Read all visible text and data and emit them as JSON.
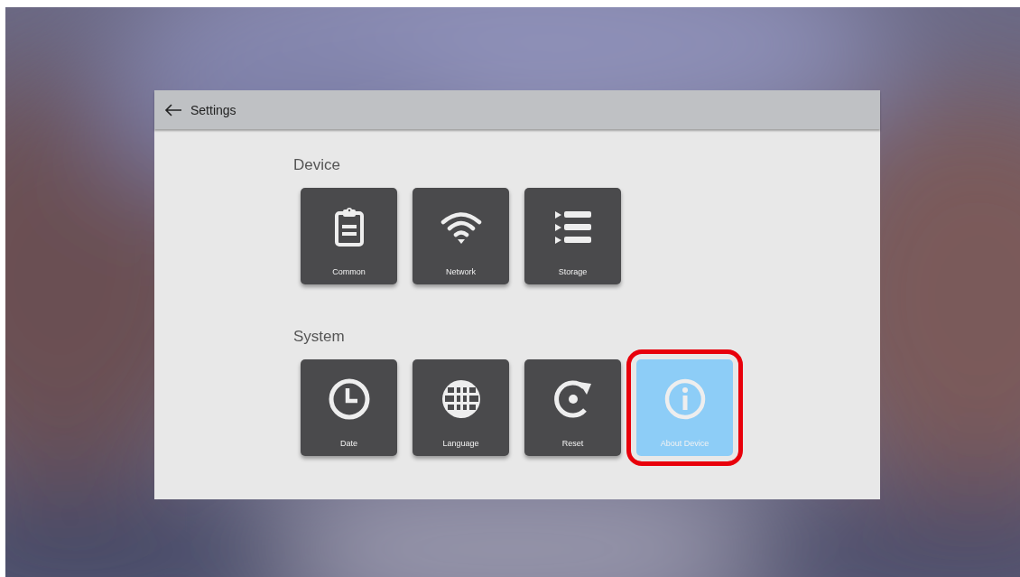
{
  "header": {
    "title": "Settings"
  },
  "sections": [
    {
      "title": "Device",
      "tiles": [
        {
          "label": "Common",
          "kind": "clipboard",
          "selected": false
        },
        {
          "label": "Network",
          "kind": "wifi",
          "selected": false
        },
        {
          "label": "Storage",
          "kind": "list",
          "selected": false
        }
      ]
    },
    {
      "title": "System",
      "tiles": [
        {
          "label": "Date",
          "kind": "clock",
          "selected": false
        },
        {
          "label": "Language",
          "kind": "globe",
          "selected": false
        },
        {
          "label": "Reset",
          "kind": "reset",
          "selected": false
        },
        {
          "label": "About Device",
          "kind": "info",
          "selected": true
        }
      ]
    }
  ]
}
